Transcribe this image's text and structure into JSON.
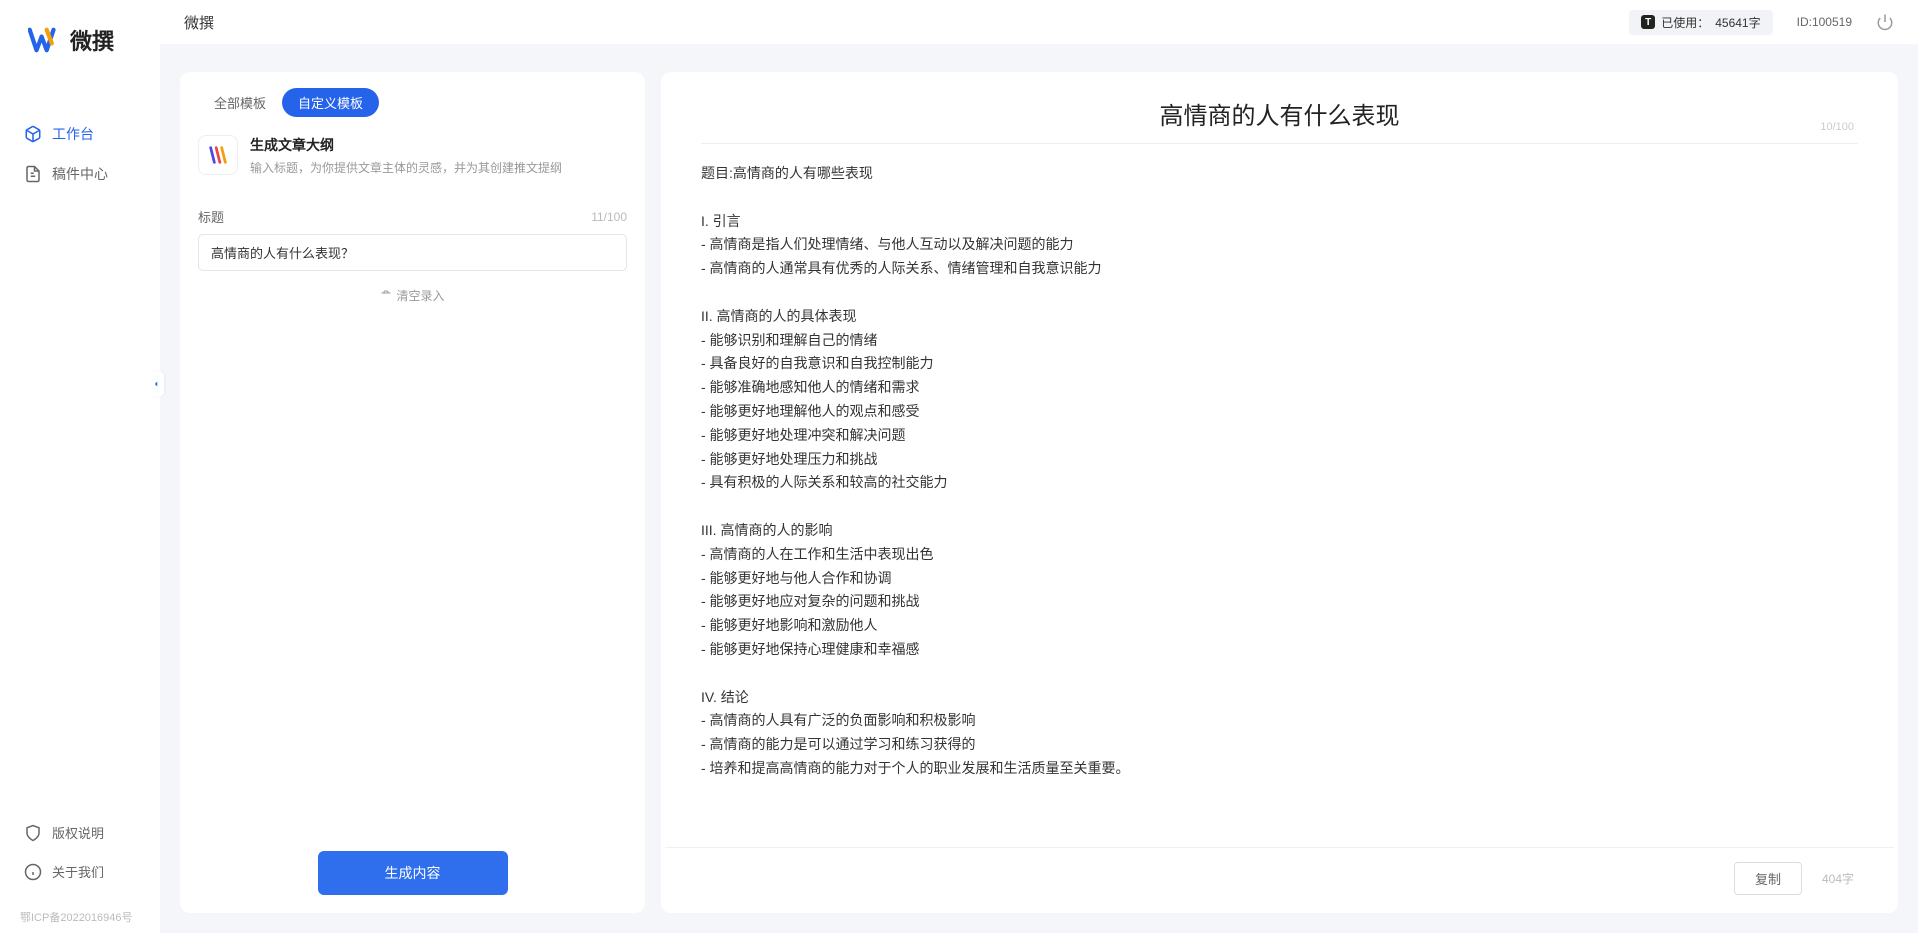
{
  "app": {
    "name": "微撰",
    "logo_text": "微撰"
  },
  "topbar": {
    "title": "微撰",
    "usage_label": "已使用：",
    "usage_value": "45641字",
    "id_label": "ID:",
    "id_value": "100519"
  },
  "sidebar": {
    "nav": [
      {
        "key": "workbench",
        "label": "工作台",
        "active": true
      },
      {
        "key": "drafts",
        "label": "稿件中心",
        "active": false
      }
    ],
    "bottom": [
      {
        "key": "copyright",
        "label": "版权说明"
      },
      {
        "key": "about",
        "label": "关于我们"
      }
    ],
    "icp": "鄂ICP备2022016946号"
  },
  "left_panel": {
    "tabs": [
      {
        "key": "all",
        "label": "全部模板",
        "active": false
      },
      {
        "key": "custom",
        "label": "自定义模板",
        "active": true
      }
    ],
    "template": {
      "title": "生成文章大纲",
      "desc": "输入标题，为你提供文章主体的灵感，并为其创建推文提纲"
    },
    "form": {
      "title_label": "标题",
      "title_count": "11/100",
      "title_value": "高情商的人有什么表现？",
      "clear_label": "清空录入"
    },
    "generate_btn": "生成内容"
  },
  "right_panel": {
    "title": "高情商的人有什么表现",
    "top_count": "10/100",
    "content": "题目:高情商的人有哪些表现\n\nI. 引言\n- 高情商是指人们处理情绪、与他人互动以及解决问题的能力\n- 高情商的人通常具有优秀的人际关系、情绪管理和自我意识能力\n\nII. 高情商的人的具体表现\n- 能够识别和理解自己的情绪\n- 具备良好的自我意识和自我控制能力\n- 能够准确地感知他人的情绪和需求\n- 能够更好地理解他人的观点和感受\n- 能够更好地处理冲突和解决问题\n- 能够更好地处理压力和挑战\n- 具有积极的人际关系和较高的社交能力\n\nIII. 高情商的人的影响\n- 高情商的人在工作和生活中表现出色\n- 能够更好地与他人合作和协调\n- 能够更好地应对复杂的问题和挑战\n- 能够更好地影响和激励他人\n- 能够更好地保持心理健康和幸福感\n\nIV. 结论\n- 高情商的人具有广泛的负面影响和积极影响\n- 高情商的能力是可以通过学习和练习获得的\n- 培养和提高高情商的能力对于个人的职业发展和生活质量至关重要。",
    "copy_btn": "复制",
    "word_count": "404字"
  }
}
